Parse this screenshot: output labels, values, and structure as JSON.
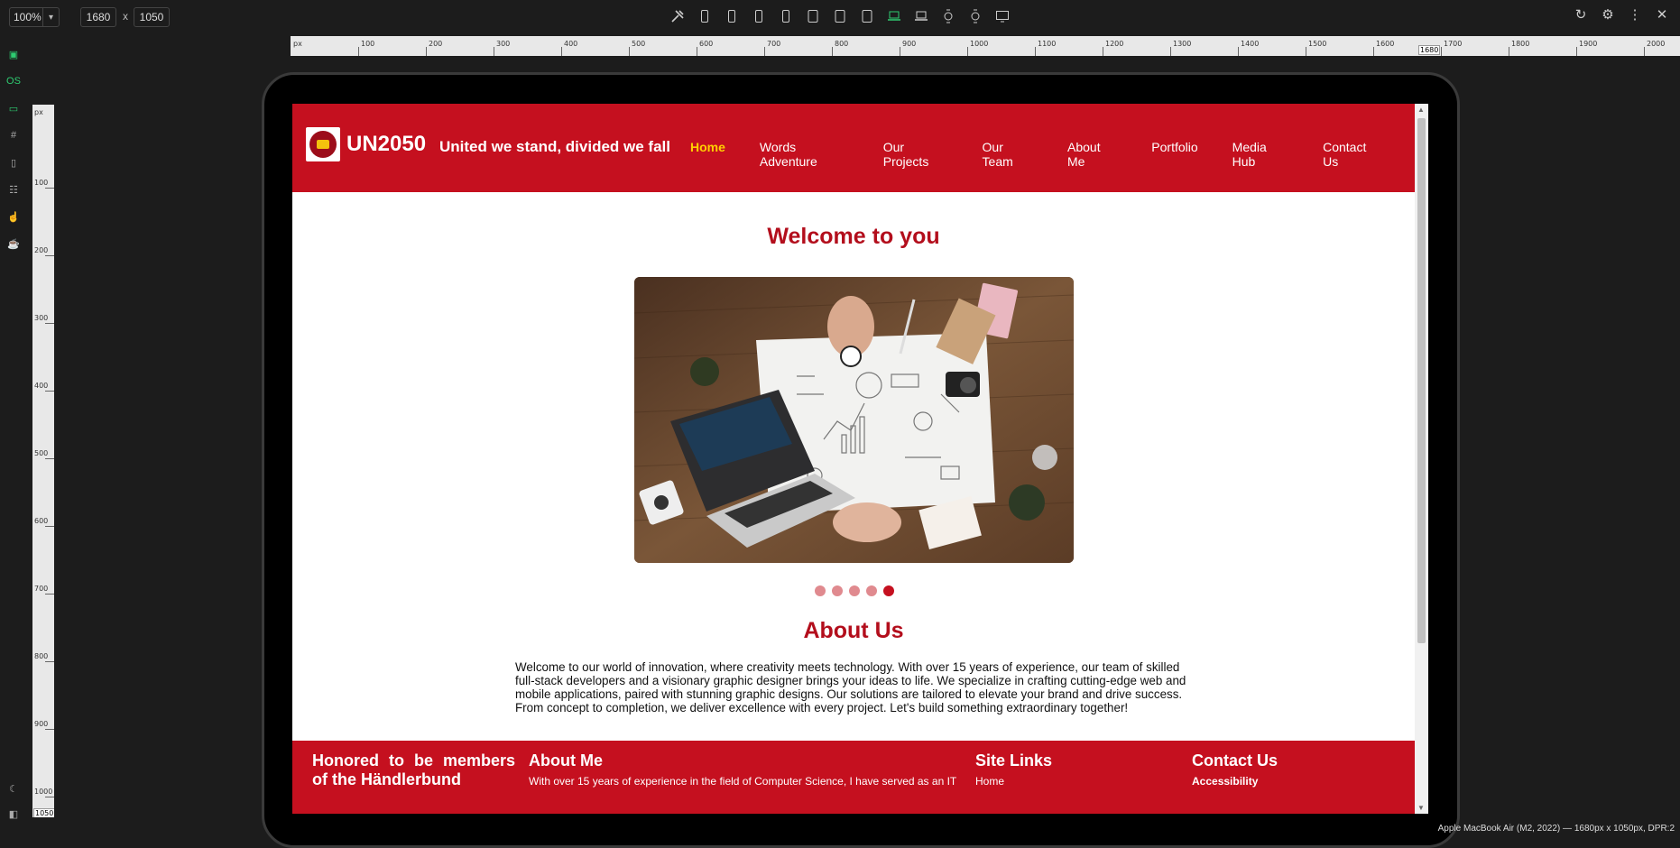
{
  "toolbar": {
    "zoom": "100%",
    "width": "1680",
    "height": "1050",
    "x_separator": "x",
    "device_icons": [
      "tools-icon",
      "phone-icon",
      "phone-icon",
      "phone-icon",
      "phone-icon",
      "tablet-icon",
      "tablet-icon",
      "tablet-icon",
      "laptop-icon",
      "laptop-icon",
      "watch-icon",
      "watch-icon",
      "desktop-icon"
    ],
    "active_device_index": 8,
    "right_icons": [
      "reload-icon",
      "settings-icon",
      "more-icon",
      "close-icon"
    ]
  },
  "ruler": {
    "h_unit": "px",
    "h_ticks": [
      "100",
      "200",
      "300",
      "400",
      "500",
      "600",
      "700",
      "800",
      "900",
      "1000",
      "1100",
      "1200",
      "1300",
      "1400",
      "1500",
      "1600",
      "1700",
      "1800",
      "1900",
      "2000"
    ],
    "h_marker": "1680",
    "v_unit": "px",
    "v_ticks": [
      "100",
      "200",
      "300",
      "400",
      "500",
      "600",
      "700",
      "800",
      "900",
      "1000"
    ],
    "v_marker": "1050"
  },
  "site": {
    "brand": "UN2050",
    "tagline": "United we stand, divided we fall",
    "nav": [
      "Home",
      "Words Adventure",
      "Our Projects",
      "Our Team",
      "About Me",
      "Portfolio",
      "Media Hub",
      "Contact Us"
    ],
    "active_nav": "Home",
    "welcome_title": "Welcome to you",
    "slider_dots": 5,
    "active_dot_index": 4,
    "about_title": "About Us",
    "about_text": "Welcome to our world of innovation, where creativity meets technology. With over 15 years of experience, our team of skilled full-stack developers and a visionary graphic designer brings your ideas to life. We specialize in crafting cutting-edge web and mobile applications, paired with stunning graphic designs. Our solutions are tailored to elevate your brand and drive success. From concept to completion, we deliver excellence with every project. Let's build something extraordinary together!",
    "footer": {
      "honored": "Honored to be members of the Händlerbund",
      "about_title": "About Me",
      "about_text": "With over 15 years of experience in the field of Computer Science, I have served as an IT",
      "links_title": "Site Links",
      "links_first": "Home",
      "contact_title": "Contact Us",
      "contact_first": "Accessibility"
    }
  },
  "status_text": "Apple MacBook Air (M2, 2022) — 1680px x 1050px, DPR:2",
  "colors": {
    "brand_red": "#c5101f",
    "nav_active": "#ffd000",
    "heading_red": "#b30e1c",
    "device_active": "#2ecc71"
  }
}
